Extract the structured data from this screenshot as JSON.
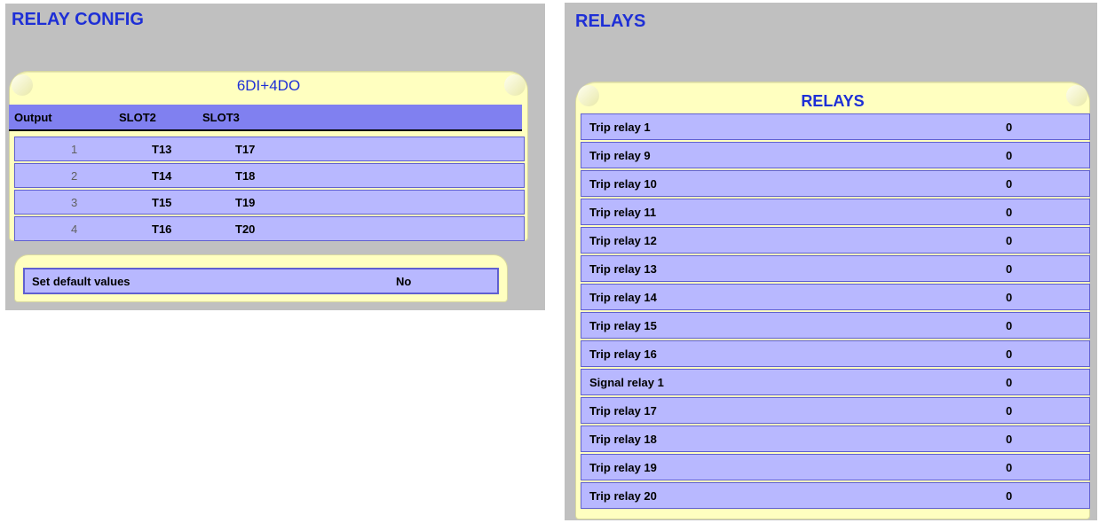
{
  "relay_config": {
    "title": "RELAY CONFIG",
    "card_tab": "6DI+4DO",
    "columns": [
      "Output",
      "SLOT2",
      "SLOT3"
    ],
    "rows": [
      {
        "output": "1",
        "slot2": "T13",
        "slot3": "T17"
      },
      {
        "output": "2",
        "slot2": "T14",
        "slot3": "T18"
      },
      {
        "output": "3",
        "slot2": "T15",
        "slot3": "T19"
      },
      {
        "output": "4",
        "slot2": "T16",
        "slot3": "T20"
      }
    ],
    "default_values": {
      "label": "Set default values",
      "value": "No"
    }
  },
  "relays": {
    "title": "RELAYS",
    "card_tab": "RELAYS",
    "rows": [
      {
        "name": "Trip relay 1",
        "value": "0"
      },
      {
        "name": "Trip relay 9",
        "value": "0"
      },
      {
        "name": "Trip relay 10",
        "value": "0"
      },
      {
        "name": "Trip relay 11",
        "value": "0"
      },
      {
        "name": "Trip relay 12",
        "value": "0"
      },
      {
        "name": "Trip relay 13",
        "value": "0"
      },
      {
        "name": "Trip relay 14",
        "value": "0"
      },
      {
        "name": "Trip relay 15",
        "value": "0"
      },
      {
        "name": "Trip relay 16",
        "value": "0"
      },
      {
        "name": "Signal relay 1",
        "value": "0"
      },
      {
        "name": "Trip relay 17",
        "value": "0"
      },
      {
        "name": "Trip relay 18",
        "value": "0"
      },
      {
        "name": "Trip relay 19",
        "value": "0"
      },
      {
        "name": "Trip relay 20",
        "value": "0"
      }
    ]
  },
  "colors": {
    "panel_bg": "#c0c0c0",
    "title_blue": "#1e2fd6",
    "tab_yellow": "#ffffc0",
    "header_purple": "#8080f0",
    "row_lavender": "#b8b8ff",
    "row_border": "#6060d0"
  }
}
